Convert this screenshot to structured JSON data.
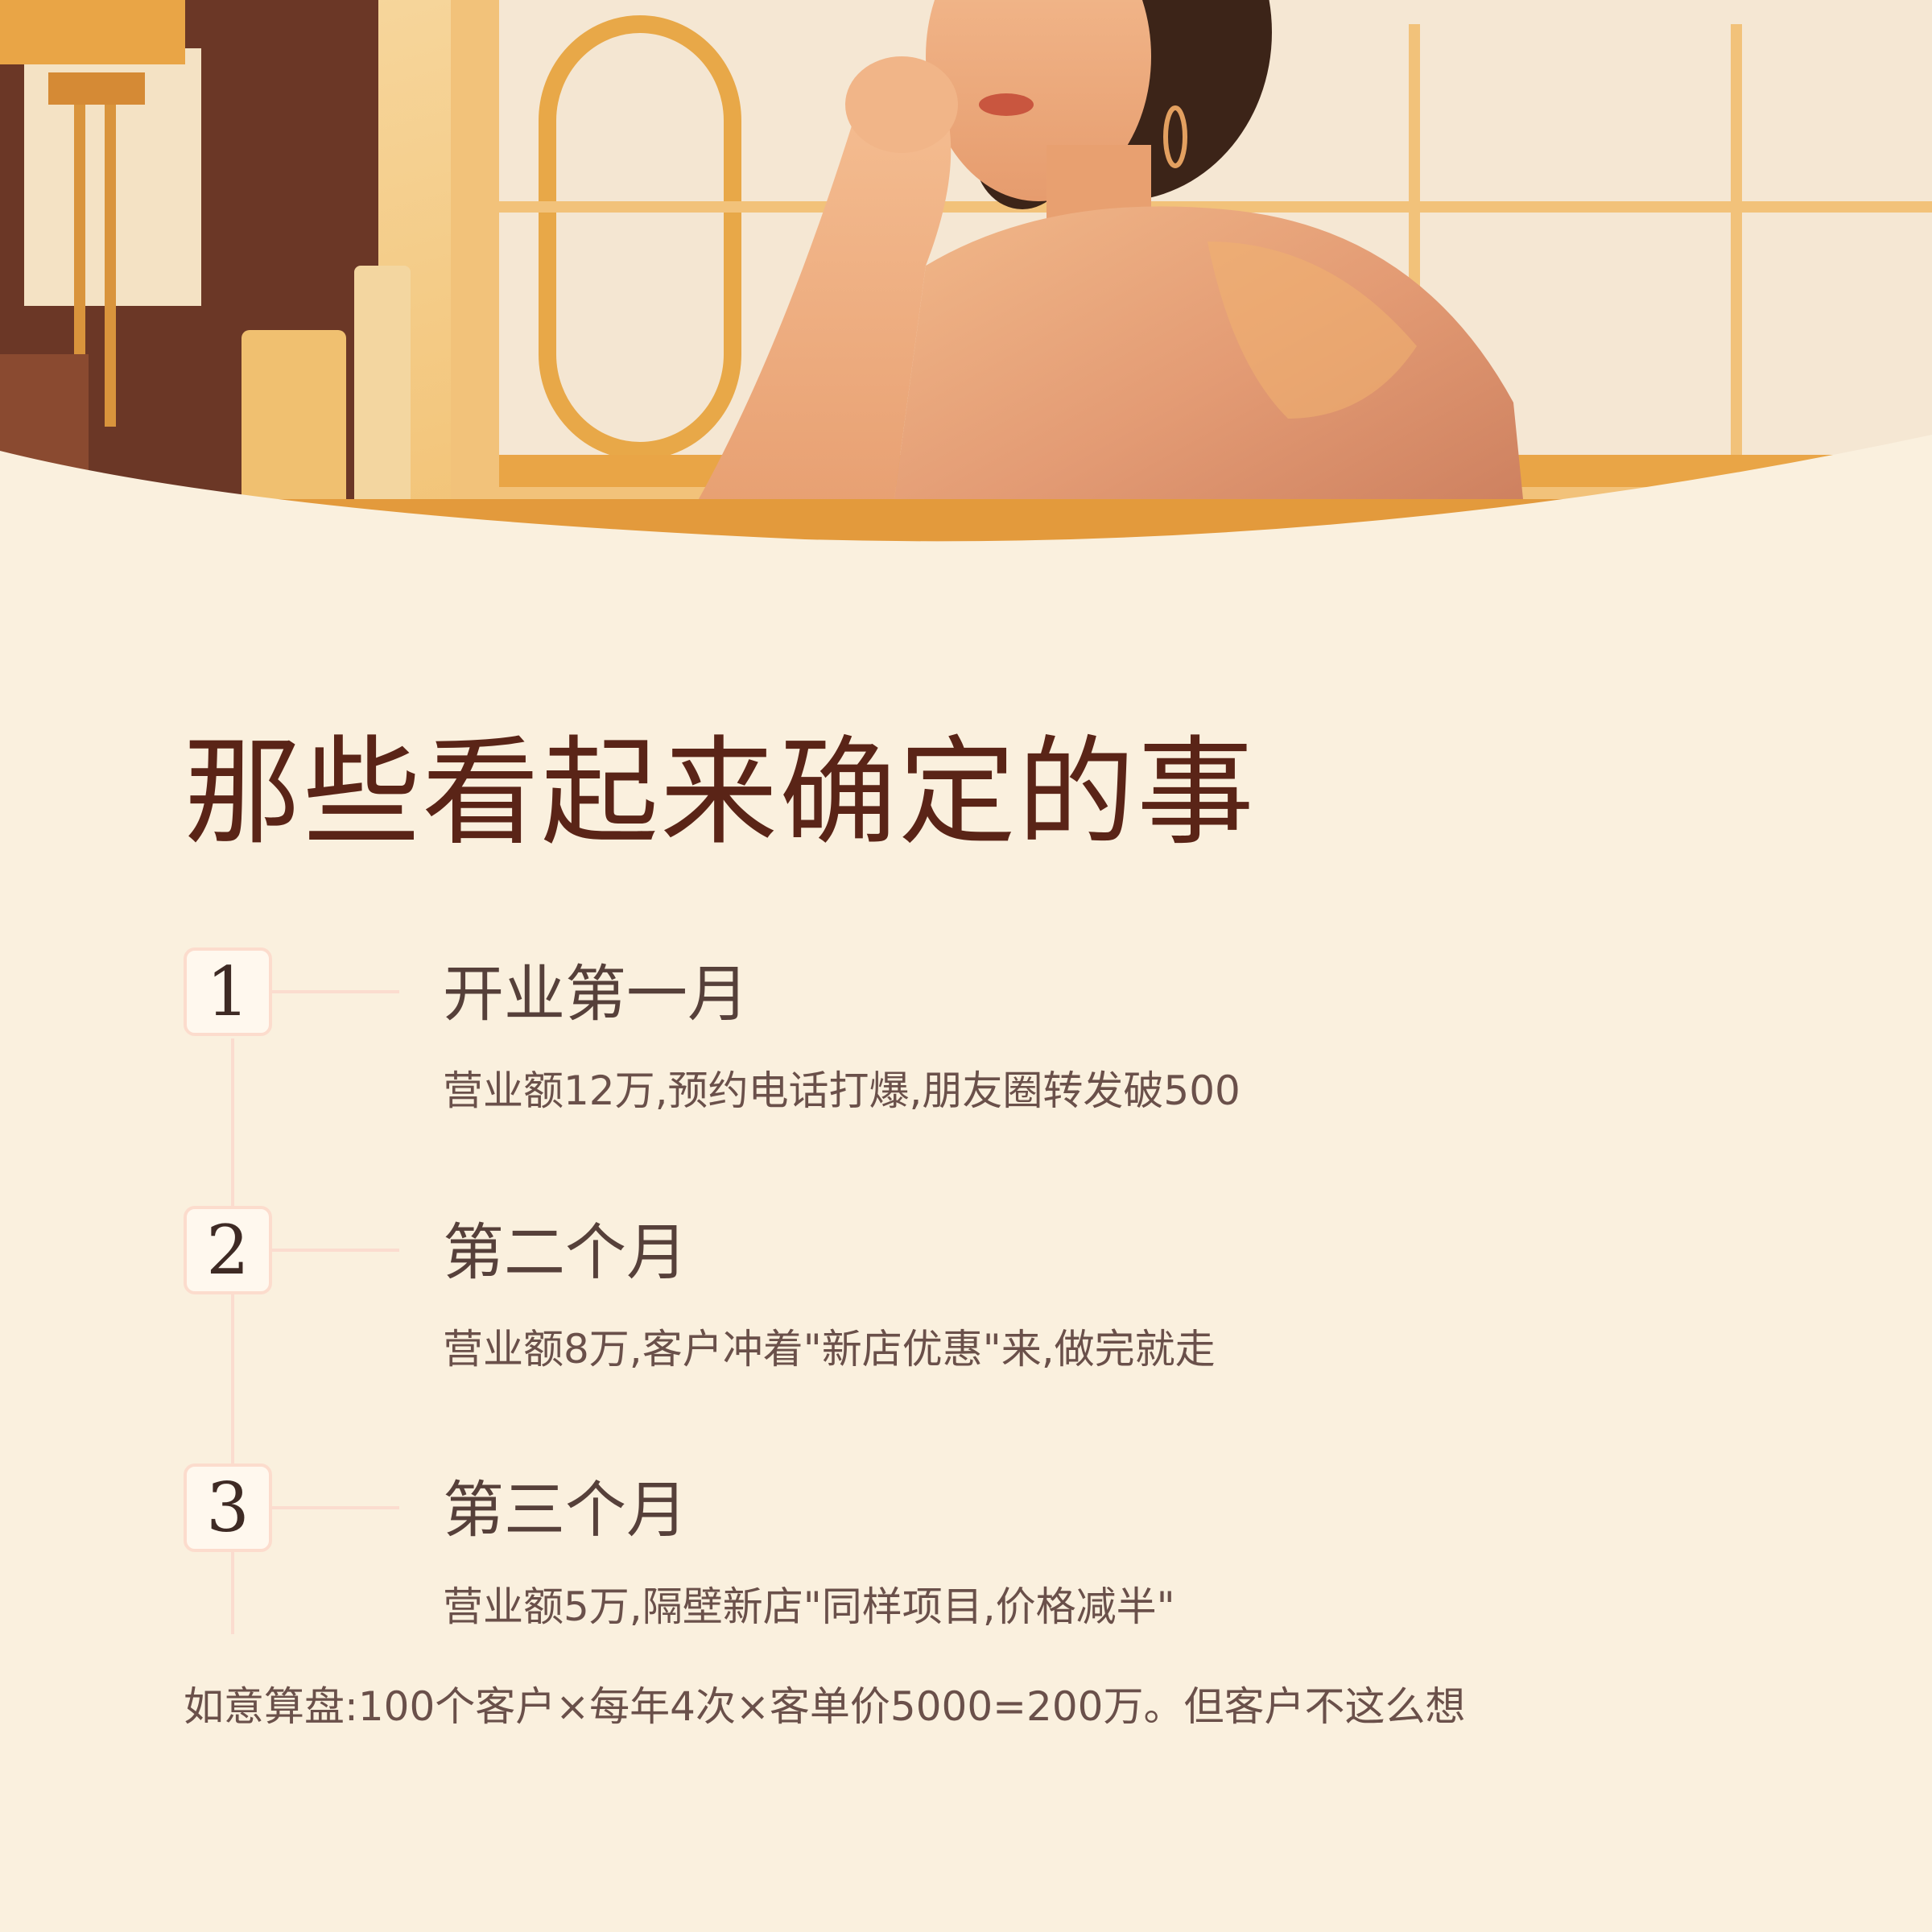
{
  "hero": {
    "illustration": "retro-woman-cafe-illustration"
  },
  "title": "那些看起来确定的事",
  "steps": [
    {
      "number": "1",
      "title": "开业第一月",
      "desc": "营业额12万,预约电话打爆,朋友圈转发破500"
    },
    {
      "number": "2",
      "title": "第二个月",
      "desc": "营业额8万,客户冲着\"新店优惠\"来,做完就走"
    },
    {
      "number": "3",
      "title": "第三个月",
      "desc": "营业额5万,隔壁新店\"同样项目,价格减半\""
    }
  ],
  "footnote": "如意算盘:100个客户×每年4次×客单价5000=200万。但客户不这么想",
  "colors": {
    "background": "#FAF0DE",
    "title": "#5A2417",
    "accent_line": "#FBDCCF",
    "text": "#6A504A"
  }
}
